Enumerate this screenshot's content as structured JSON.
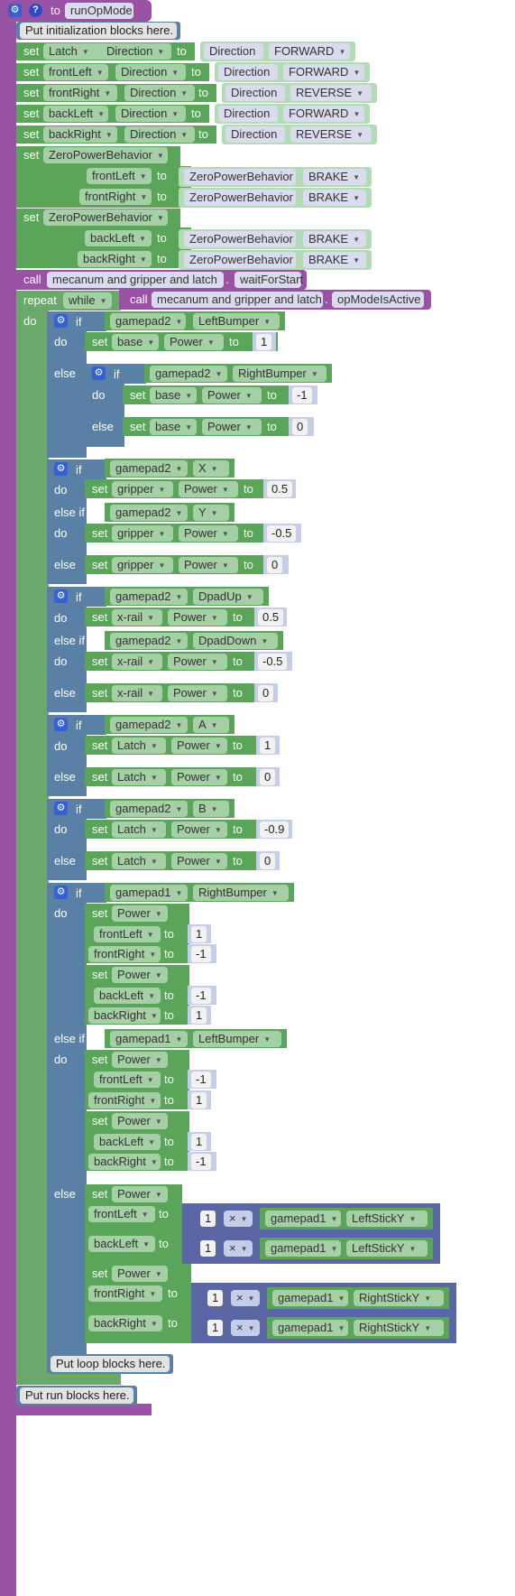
{
  "function": {
    "label": "to",
    "name": "runOpMode",
    "settings_icon": "gear-icon",
    "help_icon": "question-icon"
  },
  "comments": {
    "init": "Put initialization blocks here.",
    "loop": "Put loop blocks here.",
    "run": "Put run blocks here."
  },
  "kw": {
    "set": "set",
    "to": "to",
    "call": "call",
    "repeat": "repeat",
    "do": "do",
    "if": "if",
    "else": "else",
    "else_if": "else if",
    "dot": ".",
    "times": "×"
  },
  "direction_sets": [
    {
      "motor": "Latch",
      "prop": "Direction",
      "enum": "Direction",
      "value": "FORWARD"
    },
    {
      "motor": "frontLeft",
      "prop": "Direction",
      "enum": "Direction",
      "value": "FORWARD"
    },
    {
      "motor": "frontRight",
      "prop": "Direction",
      "enum": "Direction",
      "value": "REVERSE"
    },
    {
      "motor": "backLeft",
      "prop": "Direction",
      "enum": "Direction",
      "value": "FORWARD"
    },
    {
      "motor": "backRight",
      "prop": "Direction",
      "enum": "Direction",
      "value": "REVERSE"
    }
  ],
  "zpb": {
    "prop": "ZeroPowerBehavior",
    "enum": "ZeroPowerBehavior",
    "value": "BRAKE",
    "group1": [
      "frontLeft",
      "frontRight"
    ],
    "group2": [
      "backLeft",
      "backRight"
    ]
  },
  "wait_call": {
    "object": "mecanum and gripper and latch",
    "method": "waitForStart"
  },
  "repeat": {
    "mode": "while",
    "object": "mecanum and gripper and latch",
    "method": "opModeIsActive"
  },
  "if_base": {
    "gamepad": "gamepad2",
    "button": "LeftBumper",
    "motor": "base",
    "prop": "Power",
    "value": "1",
    "inner_button": "RightBumper",
    "inner_value": "-1",
    "else_value": "0"
  },
  "if_gripper": {
    "gamepad": "gamepad2",
    "button": "X",
    "button2": "Y",
    "motor": "gripper",
    "prop": "Power",
    "v1": "0.5",
    "v2": "-0.5",
    "v3": "0"
  },
  "if_xrail": {
    "gamepad": "gamepad2",
    "button": "DpadUp",
    "button2": "DpadDown",
    "motor": "x-rail",
    "prop": "Power",
    "v1": "0.5",
    "v2": "-0.5",
    "v3": "0"
  },
  "if_latch_a": {
    "gamepad": "gamepad2",
    "button": "A",
    "motor": "Latch",
    "prop": "Power",
    "v1": "1",
    "v2": "0"
  },
  "if_latch_b": {
    "gamepad": "gamepad2",
    "button": "B",
    "motor": "Latch",
    "prop": "Power",
    "v1": "-0.9",
    "v2": "0"
  },
  "drive": {
    "gamepad": "gamepad1",
    "button1": "RightBumper",
    "button2": "LeftBumper",
    "prop": "Power",
    "fl": "frontLeft",
    "fr": "frontRight",
    "bl": "backLeft",
    "br": "backRight",
    "rb": {
      "fl": "1",
      "fr": "-1",
      "bl": "-1",
      "br": "1"
    },
    "lb": {
      "fl": "-1",
      "fr": "1",
      "bl": "1",
      "br": "-1"
    },
    "mult": "1",
    "stick_left": "LeftStickY",
    "stick_right": "RightStickY"
  }
}
